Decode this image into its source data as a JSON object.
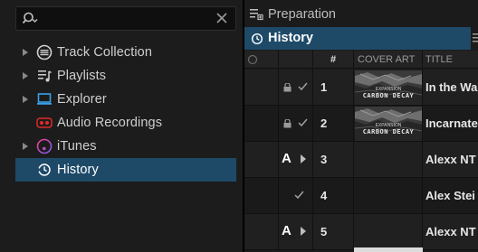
{
  "search": {
    "value": ""
  },
  "sidebar": {
    "items": [
      {
        "label": "Track Collection",
        "icon": "track-collection-icon",
        "expandable": true
      },
      {
        "label": "Playlists",
        "icon": "playlists-icon",
        "expandable": true
      },
      {
        "label": "Explorer",
        "icon": "explorer-icon",
        "expandable": true
      },
      {
        "label": "Audio Recordings",
        "icon": "audio-recordings-icon",
        "expandable": false
      },
      {
        "label": "iTunes",
        "icon": "itunes-icon",
        "expandable": true
      },
      {
        "label": "History",
        "icon": "history-icon",
        "expandable": false,
        "selected": true
      }
    ]
  },
  "playlists": {
    "preparation_label": "Preparation",
    "current_label": "History"
  },
  "table": {
    "headers": {
      "number": "#",
      "cover_art": "COVER ART",
      "title": "TITLE"
    },
    "rows": [
      {
        "flag": "",
        "locked": true,
        "checked": true,
        "number": "1",
        "art": true,
        "art_top": "EXPANSION",
        "art_label": "CARBON DECAY",
        "title": "In  the Wa"
      },
      {
        "flag": "",
        "locked": true,
        "checked": true,
        "number": "2",
        "art": true,
        "art_top": "EXPANSION",
        "art_label": "CARBON DECAY",
        "title": "Incarnate"
      },
      {
        "flag": "A",
        "locked": false,
        "checked": false,
        "play": true,
        "number": "3",
        "art": false,
        "title": "Alexx NT"
      },
      {
        "flag": "",
        "locked": false,
        "checked": true,
        "number": "4",
        "art": false,
        "title": "Alex Stei"
      },
      {
        "flag": "A",
        "locked": false,
        "checked": false,
        "play": true,
        "number": "5",
        "art": false,
        "title": "Alexx NT"
      }
    ]
  },
  "colors": {
    "selection": "#1e4a68",
    "panel": "#1c1c1c",
    "itunes_gradient": [
      "#f2408f",
      "#7a5cf5"
    ],
    "recording": "#e02a2a",
    "explorer": "#3aa0e8"
  }
}
